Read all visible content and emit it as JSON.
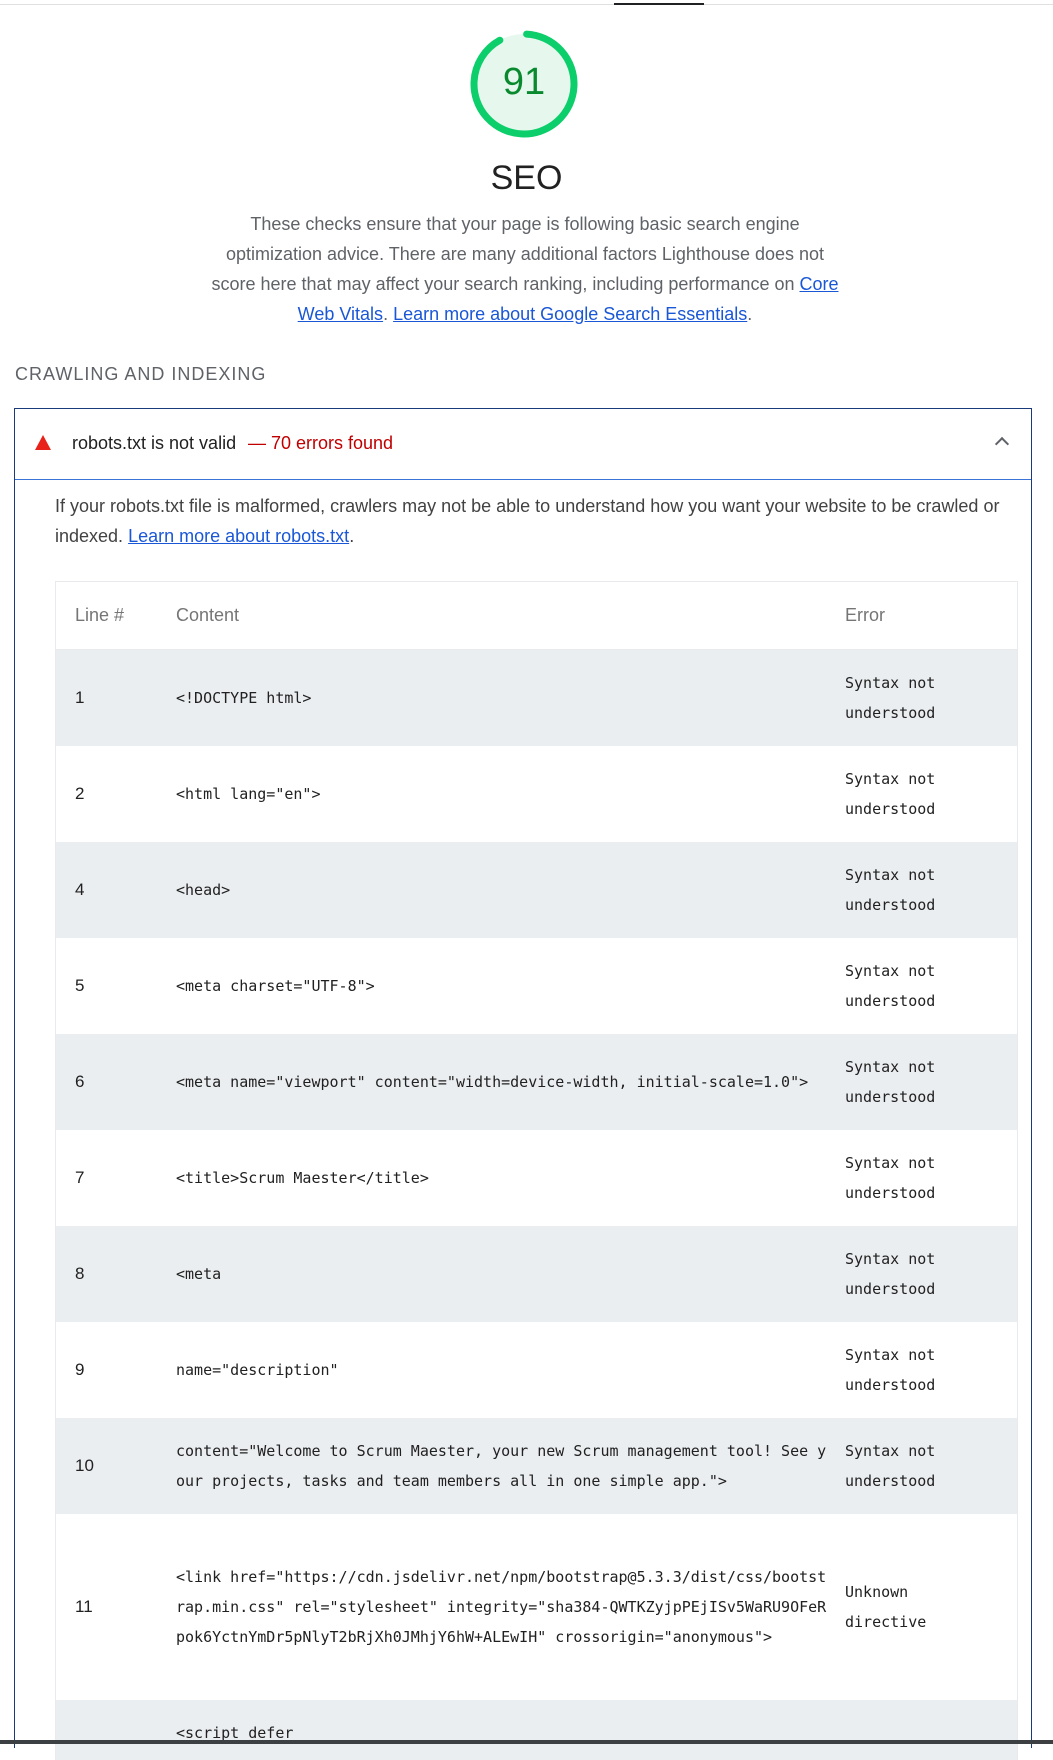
{
  "score": {
    "value": "91",
    "fraction": 0.91,
    "color": "#0cce6b"
  },
  "category": {
    "title": "SEO"
  },
  "description": {
    "text": "These checks ensure that your page is following basic search engine optimization advice. There are many additional factors Lighthouse does not score here that may affect your search ranking, including performance on ",
    "link1": "Core Web Vitals",
    "sep": ". ",
    "link2": "Learn more about Google Search Essentials",
    "end": "."
  },
  "group": {
    "title": "Crawling and Indexing"
  },
  "audit": {
    "title": "robots.txt is not valid",
    "display_value": "— 70 errors found",
    "description": "If your robots.txt file is malformed, crawlers may not be able to understand how you want your website to be crawled or indexed. ",
    "link": "Learn more about robots.txt",
    "link_end": "."
  },
  "table": {
    "headers": [
      "Line #",
      "Content",
      "Error"
    ],
    "rows": [
      {
        "line": "1",
        "content": "<!DOCTYPE html>",
        "error": "Syntax not understood"
      },
      {
        "line": "2",
        "content": "<html lang=\"en\">",
        "error": "Syntax not understood"
      },
      {
        "line": "4",
        "content": "<head>",
        "error": "Syntax not understood"
      },
      {
        "line": "5",
        "content": "<meta charset=\"UTF-8\">",
        "error": "Syntax not understood"
      },
      {
        "line": "6",
        "content": "<meta name=\"viewport\" content=\"width=device-width, initial-scale=1.0\">",
        "error": "Syntax not understood"
      },
      {
        "line": "7",
        "content": "<title>Scrum Maester</title>",
        "error": "Syntax not understood"
      },
      {
        "line": "8",
        "content": "<meta",
        "error": "Syntax not understood"
      },
      {
        "line": "9",
        "content": "name=\"description\"",
        "error": "Syntax not understood"
      },
      {
        "line": "10",
        "content": "content=\"Welcome to Scrum Maester, your new Scrum management tool! See your projects, tasks and team members all in one simple app.\">",
        "error": "Syntax not understood"
      },
      {
        "line": "11",
        "content": "<link href=\"https://cdn.jsdelivr.net/npm/bootstrap@5.3.3/dist/css/bootstrap.min.css\" rel=\"stylesheet\" integrity=\"sha384-QWTKZyjpPEjISv5WaRU9OFeRpok6YctnYmDr5pNlyT2bRjXh0JMhjY6hW+ALEwIH\" crossorigin=\"anonymous\">",
        "error": "Unknown directive"
      },
      {
        "line": "",
        "content": "<script defer",
        "error": ""
      }
    ]
  }
}
